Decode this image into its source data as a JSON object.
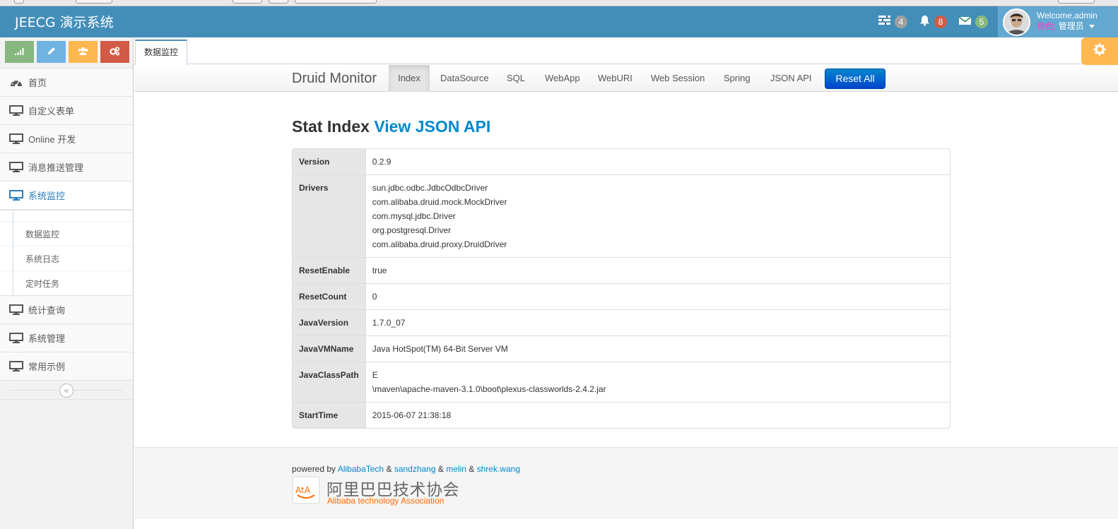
{
  "navbar": {
    "brand": "JEECG 演示系统",
    "tasks_count": "4",
    "notifications_count": "8",
    "messages_count": "5",
    "welcome": "Welcome,admin",
    "role_label": "角色:",
    "role_value": "管理员"
  },
  "colors": {
    "navbar": "#438eb9",
    "tasks_box": "#555555",
    "notifications_box": "#892e65",
    "messages_box": "#2e8965",
    "user_box": "#62a8d1",
    "shortcut_green": "#87b87f",
    "shortcut_blue": "#6fb3e0",
    "shortcut_orange": "#ffb752",
    "shortcut_red": "#d15b47",
    "active_menu": "#2b7dbc",
    "link": "#0088cc"
  },
  "sidebar": {
    "menu": [
      {
        "label": "首页",
        "icon": "dashboard-icon"
      },
      {
        "label": "自定义表单",
        "icon": "desktop-icon"
      },
      {
        "label": "Online 开发",
        "icon": "desktop-icon"
      },
      {
        "label": "消息推送管理",
        "icon": "desktop-icon"
      },
      {
        "label": "系统监控",
        "icon": "desktop-icon",
        "active": true
      },
      {
        "label": "统计查询",
        "icon": "desktop-icon"
      },
      {
        "label": "系统管理",
        "icon": "desktop-icon"
      },
      {
        "label": "常用示例",
        "icon": "desktop-icon"
      }
    ],
    "submenu": [
      "数据监控",
      "系统日志",
      "定时任务"
    ]
  },
  "tabs": [
    "数据监控"
  ],
  "druid": {
    "brand": "Druid Monitor",
    "nav": [
      "Index",
      "DataSource",
      "SQL",
      "WebApp",
      "WebURI",
      "Web Session",
      "Spring",
      "JSON API"
    ],
    "active_nav": "Index",
    "reset_button": "Reset All",
    "heading": "Stat Index",
    "heading_link": "View JSON API"
  },
  "stats": [
    {
      "key": "Version",
      "values": [
        "0.2.9"
      ]
    },
    {
      "key": "Drivers",
      "values": [
        "sun.jdbc.odbc.JdbcOdbcDriver",
        "com.alibaba.druid.mock.MockDriver",
        "com.mysql.jdbc.Driver",
        "org.postgresql.Driver",
        "com.alibaba.druid.proxy.DruidDriver"
      ]
    },
    {
      "key": "ResetEnable",
      "values": [
        "true"
      ]
    },
    {
      "key": "ResetCount",
      "values": [
        "0"
      ]
    },
    {
      "key": "JavaVersion",
      "values": [
        "1.7.0_07"
      ]
    },
    {
      "key": "JavaVMName",
      "values": [
        "Java HotSpot(TM) 64-Bit Server VM"
      ]
    },
    {
      "key": "JavaClassPath",
      "values": [
        "E",
        "\\maven\\apache-maven-3.1.0\\boot\\plexus-classworlds-2.4.2.jar"
      ]
    },
    {
      "key": "StartTime",
      "values": [
        "2015-06-07 21:38:18"
      ]
    }
  ],
  "footer": {
    "powered_by": "powered by",
    "authors": [
      "AlibabaTech",
      "sandzhang",
      "melin",
      "shrek.wang"
    ],
    "separator": "&",
    "logo_cn": "阿里巴巴技术协会",
    "logo_en": "Alibaba technology Association",
    "logo_mark": "AtA"
  }
}
